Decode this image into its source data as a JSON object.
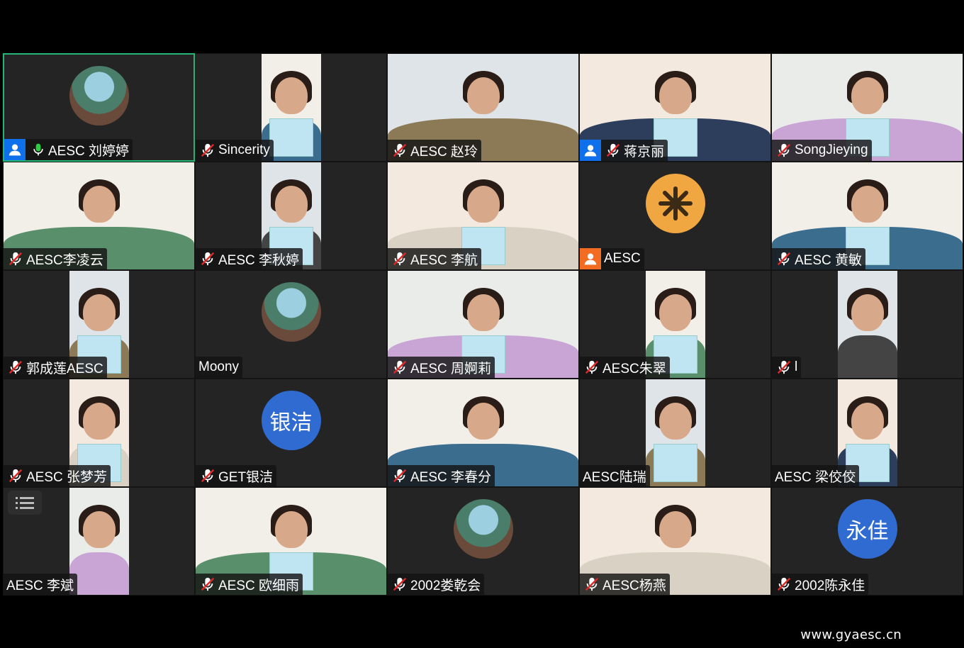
{
  "participants": [
    {
      "name": "AESC 刘婷婷",
      "muted": false,
      "host": true,
      "active": true,
      "kind": "photo-avatar"
    },
    {
      "name": "Sincerity",
      "muted": true,
      "kind": "video"
    },
    {
      "name": "AESC 赵玲",
      "muted": true,
      "kind": "video-wide"
    },
    {
      "name": "蒋京丽",
      "muted": true,
      "host": true,
      "kind": "video-wide"
    },
    {
      "name": "SongJieying",
      "muted": true,
      "kind": "video-wide"
    },
    {
      "name": "AESC李凌云",
      "muted": true,
      "kind": "video-wide"
    },
    {
      "name": "AESC 李秋婷",
      "muted": true,
      "kind": "video"
    },
    {
      "name": "AESC 李航",
      "muted": true,
      "kind": "video-wide"
    },
    {
      "name": "AESC",
      "muted": false,
      "host": true,
      "host_color": "orange",
      "kind": "logo-avatar"
    },
    {
      "name": "AESC 黄敏",
      "muted": true,
      "kind": "video-wide"
    },
    {
      "name": "郭成莲AESC",
      "muted": true,
      "kind": "video"
    },
    {
      "name": "Moony",
      "muted": false,
      "kind": "photo-avatar"
    },
    {
      "name": "AESC 周婀莉",
      "muted": true,
      "kind": "video-wide"
    },
    {
      "name": "AESC朱翠",
      "muted": true,
      "kind": "video"
    },
    {
      "name": "l",
      "muted": true,
      "kind": "video"
    },
    {
      "name": "AESC 张梦芳",
      "muted": true,
      "kind": "video"
    },
    {
      "name": "GET银洁",
      "muted": true,
      "kind": "initials",
      "initials": "银洁"
    },
    {
      "name": "AESC 李春分",
      "muted": true,
      "kind": "video-wide"
    },
    {
      "name": "AESC陆瑞",
      "muted": false,
      "kind": "video"
    },
    {
      "name": "AESC 梁佼佼",
      "muted": false,
      "kind": "video"
    },
    {
      "name": "AESC 李斌",
      "muted": false,
      "kind": "video",
      "menu": true
    },
    {
      "name": "AESC 欧细雨",
      "muted": true,
      "kind": "video-wide"
    },
    {
      "name": "2002娄乾会",
      "muted": true,
      "kind": "photo-avatar"
    },
    {
      "name": "AESC杨燕",
      "muted": true,
      "kind": "video-wide"
    },
    {
      "name": "2002陈永佳",
      "muted": true,
      "kind": "initials",
      "initials": "永佳"
    }
  ],
  "watermark": "www.gyaesc.cn",
  "colors": {
    "active_border": "#22b573",
    "host_badge": "#0e71eb",
    "host_badge_alt": "#f26d21",
    "initials_bg": "#2f6bd1",
    "logo_bg": "#f0a742"
  }
}
